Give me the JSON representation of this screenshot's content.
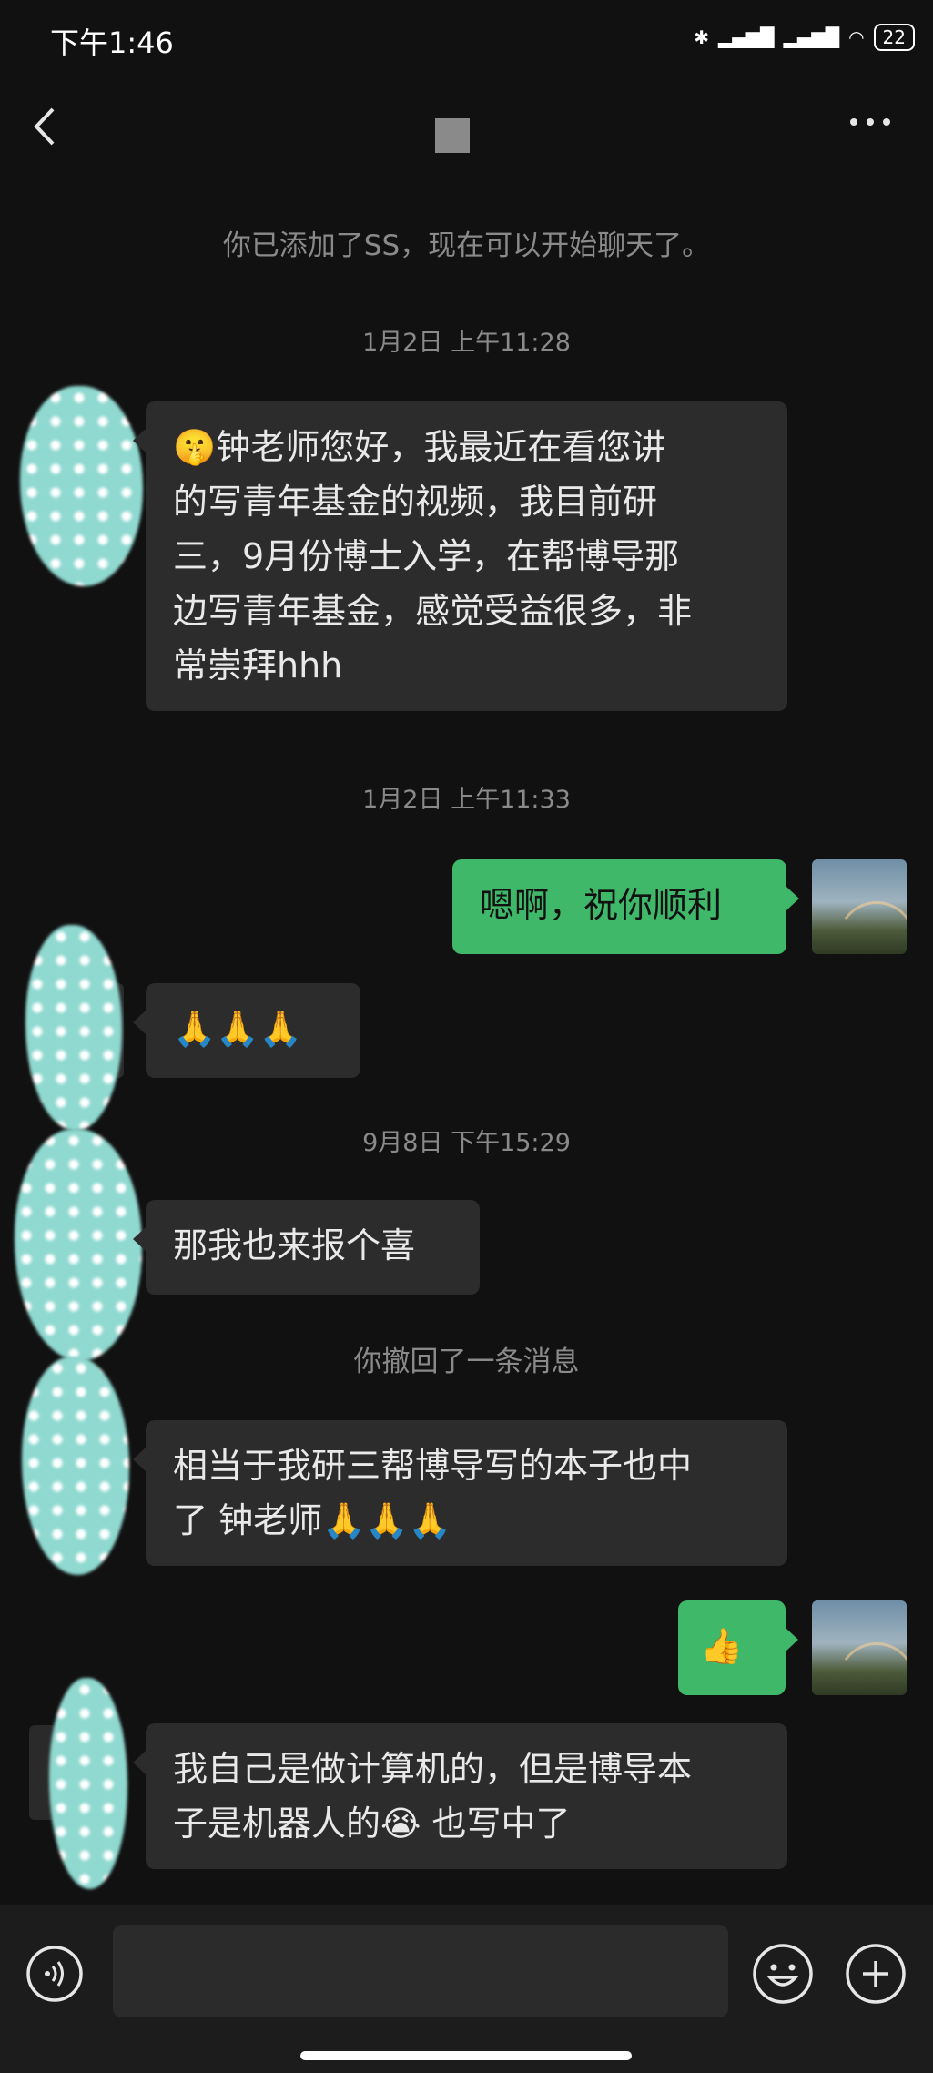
{
  "status_bar": {
    "time": "下午1:46",
    "battery": "22"
  },
  "header": {
    "back_icon": "chevron-left-icon",
    "more_icon": "more-dots-icon"
  },
  "system_message": "你已添加了SS，现在可以开始聊天了。",
  "messages": [
    {
      "type": "time",
      "text": "1月2日 上午11:28"
    },
    {
      "type": "in",
      "lines": [
        "🤫钟老师您好，我最近在看您讲",
        "的写青年基金的视频，我目前研",
        "三，9月份博士入学，在帮博导那",
        "边写青年基金，感觉受益很多，非",
        "常崇拜hhh"
      ]
    },
    {
      "type": "time",
      "text": "1月2日 上午11:33"
    },
    {
      "type": "out",
      "text": "嗯啊，祝你顺利"
    },
    {
      "type": "in",
      "text": "🙏🙏🙏"
    },
    {
      "type": "time",
      "text": "9月8日 下午15:29"
    },
    {
      "type": "in",
      "text": "那我也来报个喜"
    },
    {
      "type": "recall",
      "text": "你撤回了一条消息"
    },
    {
      "type": "in",
      "lines": [
        "相当于我研三帮博导写的本子也中",
        "了 钟老师🙏🙏🙏"
      ]
    },
    {
      "type": "out",
      "text": "👍"
    },
    {
      "type": "in",
      "lines": [
        "我自己是做计算机的，但是博导本",
        "子是机器人的😭 也写中了"
      ]
    }
  ],
  "input_bar": {
    "placeholder": "",
    "voice_icon": "voice-icon",
    "emoji_icon": "emoji-icon",
    "plus_icon": "plus-icon"
  },
  "colors": {
    "background": "#111111",
    "incoming_bubble": "#2c2c2c",
    "outgoing_bubble": "#3fb86a",
    "meta_text": "#8a8a8a"
  }
}
